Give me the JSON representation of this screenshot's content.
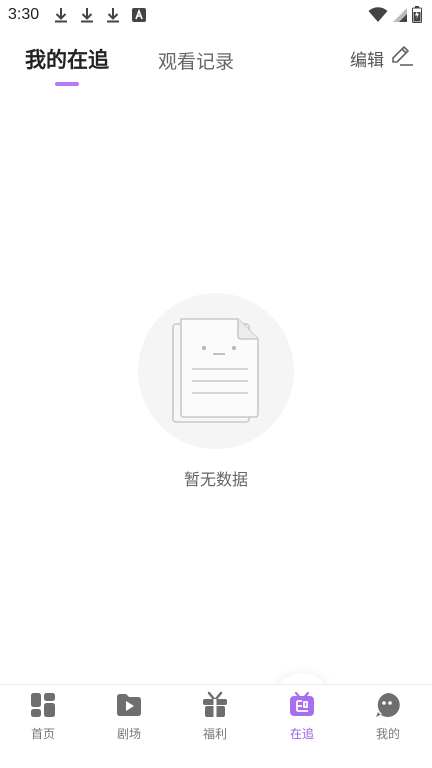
{
  "status_bar": {
    "time": "3:30",
    "left_icons": [
      "download-icon",
      "download-icon",
      "download-icon",
      "a-box-icon"
    ],
    "right_icons": [
      "wifi-icon",
      "signal-icon",
      "battery-icon"
    ]
  },
  "header": {
    "tabs": [
      {
        "label": "我的在追",
        "active": true
      },
      {
        "label": "观看记录",
        "active": false
      }
    ],
    "edit_label": "编辑",
    "accent_color": "#b77af0"
  },
  "empty_state": {
    "message": "暂无数据"
  },
  "bottom_nav": {
    "items": [
      {
        "label": "首页",
        "icon": "home-grid-icon",
        "active": false
      },
      {
        "label": "剧场",
        "icon": "play-folder-icon",
        "active": false
      },
      {
        "label": "福利",
        "icon": "gift-icon",
        "active": false
      },
      {
        "label": "在追",
        "icon": "follow-tv-icon",
        "active": true
      },
      {
        "label": "我的",
        "icon": "chat-face-icon",
        "active": false
      }
    ],
    "active_color": "#9a5ce8"
  }
}
